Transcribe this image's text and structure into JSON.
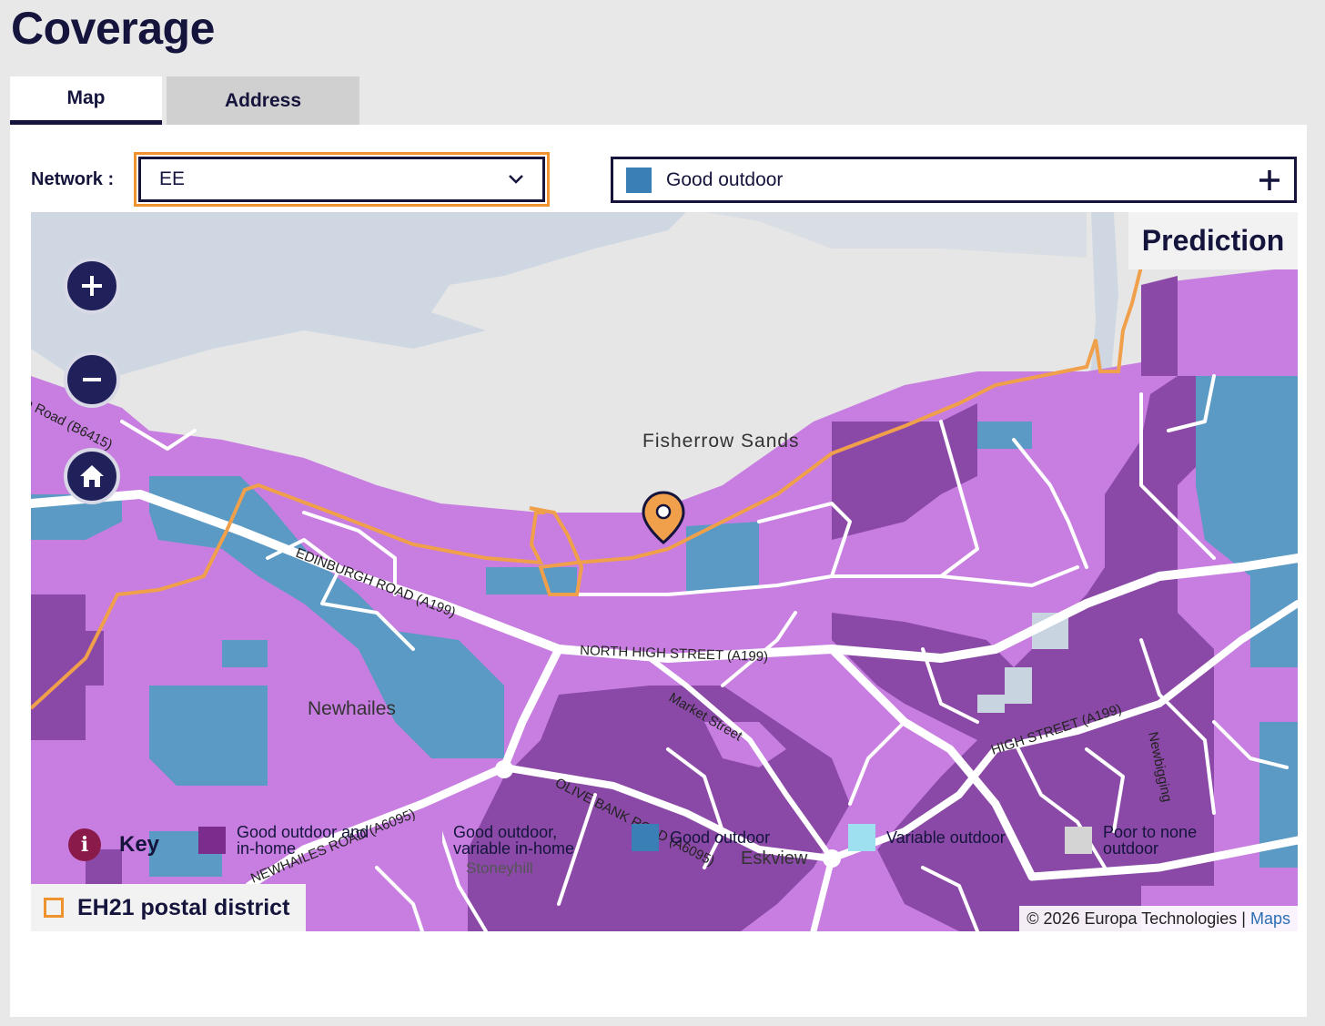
{
  "page": {
    "title": "Coverage"
  },
  "tabs": [
    {
      "label": "Map",
      "active": true
    },
    {
      "label": "Address",
      "active": false
    }
  ],
  "network": {
    "label": "Network :",
    "value": "EE"
  },
  "layer": {
    "value": "Good outdoor",
    "color": "#3a7fb5"
  },
  "map": {
    "mode_label": "Prediction",
    "place_labels": [
      "Fisherrow Sands",
      "Newhailes",
      "Eskview",
      "Stoneyhill"
    ],
    "road_labels": [
      "EDINBURGH ROAD (A199)",
      "NORTH HIGH STREET (A199)",
      "Market Street",
      "OLIVE BANK ROAD (A6095)",
      "NEWHAILES ROAD (A6095)",
      "HIGH STREET (A199)",
      "Newbigging",
      "h Road (B6415)"
    ],
    "district_label": "EH21 postal district",
    "district_color": "#f0922e",
    "attribution": "© 2026 Europa Technologies |",
    "attribution_link": "Maps",
    "controls": [
      "zoom-in",
      "zoom-out",
      "home"
    ]
  },
  "key": {
    "title": "Key",
    "items": [
      {
        "label": "Good outdoor and in-home",
        "color": "#7b2d8e"
      },
      {
        "label": "Good outdoor, variable in-home",
        "color": "#c77ee0"
      },
      {
        "label": "Good outdoor",
        "color": "#3a7fb5"
      },
      {
        "label": "Variable outdoor",
        "color": "#9ee0f0"
      },
      {
        "label": "Poor to none outdoor",
        "color": "#d4d4d4"
      }
    ]
  }
}
